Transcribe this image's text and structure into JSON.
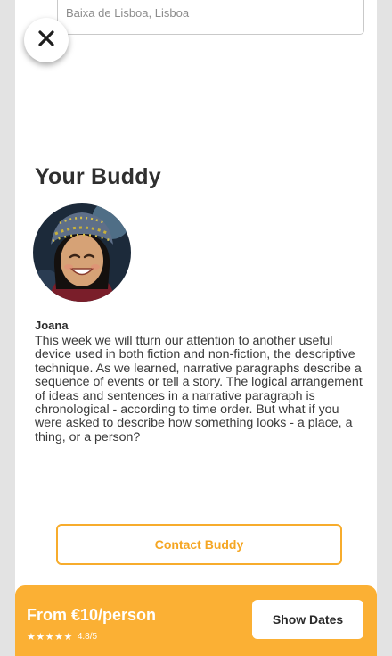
{
  "search": {
    "location_value": "Baixa de Lisboa, Lisboa"
  },
  "icons": {
    "close": "close-icon",
    "avatar": "buddy-photo",
    "stars": "star-icon"
  },
  "buddy": {
    "section_title": "Your Buddy",
    "name": "Joana",
    "bio": "This week we will tturn our attention to another useful device used in both fiction and non-fiction, the descriptive technique. As we learned, narrative paragraphs describe a sequence of events or tell a story. The logical arrangement of ideas and sentences in a narrative paragraph is chronological - according to time order. But what if you were asked to describe how something looks - a place, a thing, or a person?",
    "contact_label": "Contact Buddy"
  },
  "booking": {
    "price": "From €10/person",
    "stars": "★★★★★",
    "rating": "4.8/5",
    "rating_value": 4.8,
    "show_dates_label": "Show Dates"
  },
  "colors": {
    "accent": "#fbb034",
    "accent_text": "#f5a623",
    "background": "#e3e3e3"
  }
}
